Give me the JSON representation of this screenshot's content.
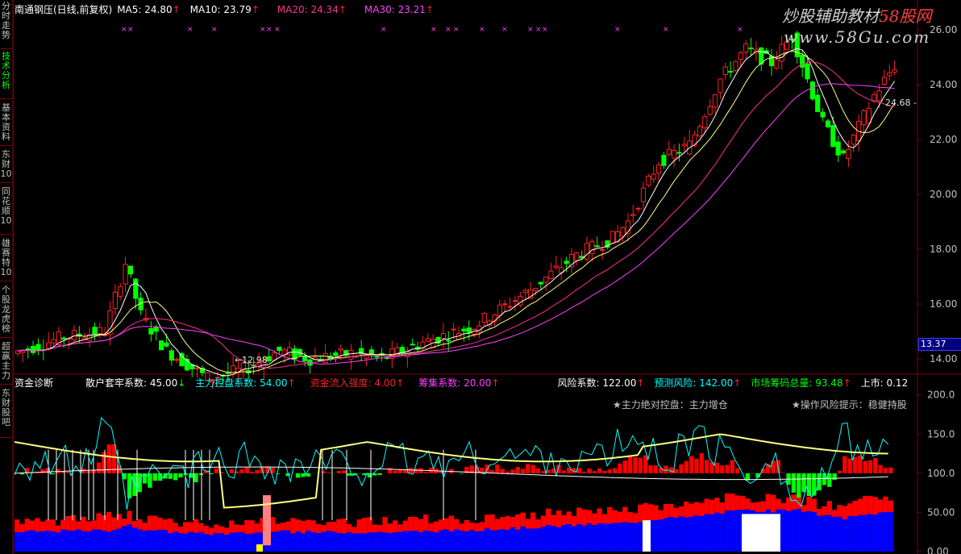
{
  "sidebar_tabs": [
    "分时走势",
    "技术分析",
    "基本资料",
    "东财10",
    "同花顺10",
    "雄赛特10",
    "个股龙虎榜",
    "超赢主力",
    "东财股吧"
  ],
  "active_tab": 1,
  "watermark": {
    "brand": "炒股辅助教材",
    "site": "58股网",
    "url": "www.58Gu.com"
  },
  "main_header": {
    "title": "南通钢压(日线,前复权)",
    "items": [
      {
        "label": "MA5: 24.80",
        "color": "#ffffff",
        "arrow": "↑",
        "arrow_color": "#ff2020"
      },
      {
        "label": "MA10: 23.79",
        "color": "#ffffff",
        "arrow": "↑",
        "arrow_color": "#ff2020"
      },
      {
        "label": "MA20: 24.34",
        "color": "#ff3090",
        "arrow": "↑",
        "arrow_color": "#ff2020"
      },
      {
        "label": "MA30: 23.21",
        "color": "#ff40ff",
        "arrow": "↑",
        "arrow_color": "#ff2020"
      }
    ]
  },
  "sub_header": {
    "title": "资金诊断",
    "items": [
      {
        "label": "散户套牢系数: 45.00",
        "color": "#ffffff",
        "arrow": "↓",
        "arrow_color": "#00ff00"
      },
      {
        "label": "主力控盘系数: 54.00",
        "color": "#00ffff",
        "arrow": "↑",
        "arrow_color": "#ff2020"
      },
      {
        "label": "资金流入强度: 4.00",
        "color": "#ff2020",
        "arrow": "↑",
        "arrow_color": "#ff2020"
      },
      {
        "label": "筹集系数: 20.00",
        "color": "#ff40ff",
        "arrow": "↑",
        "arrow_color": "#ff2020"
      },
      {
        "label": "风险系数: 122.00",
        "color": "#ffffff",
        "arrow": "↑",
        "arrow_color": "#ff2020"
      },
      {
        "label": "预测风险: 142.00",
        "color": "#00ffff",
        "arrow": "↑",
        "arrow_color": "#ff2020"
      },
      {
        "label": "市场筹码总量: 93.48",
        "color": "#00ff00",
        "arrow": "↑",
        "arrow_color": "#ff2020"
      },
      {
        "label": "上市: 0.12",
        "color": "#ffffff",
        "arrow": "",
        "arrow_color": "#ff2020"
      }
    ]
  },
  "notes": [
    {
      "text": "★主力绝对控盘：主力增仓",
      "color": "#ff2020"
    },
    {
      "text": "★操作风险提示：稳健持股",
      "color": "#ff40ff"
    }
  ],
  "price_marks": {
    "low": "←12.98",
    "high": "24.68 -",
    "last": "13.37"
  },
  "chart_data": {
    "type": "candlestick",
    "price_axis": {
      "min": 13.5,
      "max": 26.5,
      "ticks": [
        "26.00",
        "24.00",
        "22.00",
        "20.00",
        "18.00",
        "16.00",
        "14.00"
      ]
    },
    "sub_axis": {
      "min": 0,
      "max": 210,
      "ticks": [
        "200.0",
        "150.0",
        "100.0",
        "50.00",
        "0.00"
      ]
    }
  },
  "colors": {
    "up": "#ff2020",
    "down": "#00ff00",
    "axis": "#800000",
    "ma5": "#ffffff",
    "ma10": "#ffff80",
    "ma20": "#ff3090",
    "ma30": "#ff40ff"
  }
}
